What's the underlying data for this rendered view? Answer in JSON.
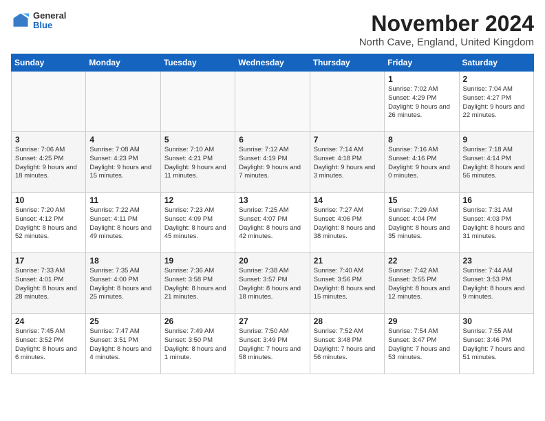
{
  "header": {
    "logo_general": "General",
    "logo_blue": "Blue",
    "month_title": "November 2024",
    "location": "North Cave, England, United Kingdom"
  },
  "weekdays": [
    "Sunday",
    "Monday",
    "Tuesday",
    "Wednesday",
    "Thursday",
    "Friday",
    "Saturday"
  ],
  "weeks": [
    [
      {
        "day": "",
        "info": ""
      },
      {
        "day": "",
        "info": ""
      },
      {
        "day": "",
        "info": ""
      },
      {
        "day": "",
        "info": ""
      },
      {
        "day": "",
        "info": ""
      },
      {
        "day": "1",
        "info": "Sunrise: 7:02 AM\nSunset: 4:29 PM\nDaylight: 9 hours and 26 minutes."
      },
      {
        "day": "2",
        "info": "Sunrise: 7:04 AM\nSunset: 4:27 PM\nDaylight: 9 hours and 22 minutes."
      }
    ],
    [
      {
        "day": "3",
        "info": "Sunrise: 7:06 AM\nSunset: 4:25 PM\nDaylight: 9 hours and 18 minutes."
      },
      {
        "day": "4",
        "info": "Sunrise: 7:08 AM\nSunset: 4:23 PM\nDaylight: 9 hours and 15 minutes."
      },
      {
        "day": "5",
        "info": "Sunrise: 7:10 AM\nSunset: 4:21 PM\nDaylight: 9 hours and 11 minutes."
      },
      {
        "day": "6",
        "info": "Sunrise: 7:12 AM\nSunset: 4:19 PM\nDaylight: 9 hours and 7 minutes."
      },
      {
        "day": "7",
        "info": "Sunrise: 7:14 AM\nSunset: 4:18 PM\nDaylight: 9 hours and 3 minutes."
      },
      {
        "day": "8",
        "info": "Sunrise: 7:16 AM\nSunset: 4:16 PM\nDaylight: 9 hours and 0 minutes."
      },
      {
        "day": "9",
        "info": "Sunrise: 7:18 AM\nSunset: 4:14 PM\nDaylight: 8 hours and 56 minutes."
      }
    ],
    [
      {
        "day": "10",
        "info": "Sunrise: 7:20 AM\nSunset: 4:12 PM\nDaylight: 8 hours and 52 minutes."
      },
      {
        "day": "11",
        "info": "Sunrise: 7:22 AM\nSunset: 4:11 PM\nDaylight: 8 hours and 49 minutes."
      },
      {
        "day": "12",
        "info": "Sunrise: 7:23 AM\nSunset: 4:09 PM\nDaylight: 8 hours and 45 minutes."
      },
      {
        "day": "13",
        "info": "Sunrise: 7:25 AM\nSunset: 4:07 PM\nDaylight: 8 hours and 42 minutes."
      },
      {
        "day": "14",
        "info": "Sunrise: 7:27 AM\nSunset: 4:06 PM\nDaylight: 8 hours and 38 minutes."
      },
      {
        "day": "15",
        "info": "Sunrise: 7:29 AM\nSunset: 4:04 PM\nDaylight: 8 hours and 35 minutes."
      },
      {
        "day": "16",
        "info": "Sunrise: 7:31 AM\nSunset: 4:03 PM\nDaylight: 8 hours and 31 minutes."
      }
    ],
    [
      {
        "day": "17",
        "info": "Sunrise: 7:33 AM\nSunset: 4:01 PM\nDaylight: 8 hours and 28 minutes."
      },
      {
        "day": "18",
        "info": "Sunrise: 7:35 AM\nSunset: 4:00 PM\nDaylight: 8 hours and 25 minutes."
      },
      {
        "day": "19",
        "info": "Sunrise: 7:36 AM\nSunset: 3:58 PM\nDaylight: 8 hours and 21 minutes."
      },
      {
        "day": "20",
        "info": "Sunrise: 7:38 AM\nSunset: 3:57 PM\nDaylight: 8 hours and 18 minutes."
      },
      {
        "day": "21",
        "info": "Sunrise: 7:40 AM\nSunset: 3:56 PM\nDaylight: 8 hours and 15 minutes."
      },
      {
        "day": "22",
        "info": "Sunrise: 7:42 AM\nSunset: 3:55 PM\nDaylight: 8 hours and 12 minutes."
      },
      {
        "day": "23",
        "info": "Sunrise: 7:44 AM\nSunset: 3:53 PM\nDaylight: 8 hours and 9 minutes."
      }
    ],
    [
      {
        "day": "24",
        "info": "Sunrise: 7:45 AM\nSunset: 3:52 PM\nDaylight: 8 hours and 6 minutes."
      },
      {
        "day": "25",
        "info": "Sunrise: 7:47 AM\nSunset: 3:51 PM\nDaylight: 8 hours and 4 minutes."
      },
      {
        "day": "26",
        "info": "Sunrise: 7:49 AM\nSunset: 3:50 PM\nDaylight: 8 hours and 1 minute."
      },
      {
        "day": "27",
        "info": "Sunrise: 7:50 AM\nSunset: 3:49 PM\nDaylight: 7 hours and 58 minutes."
      },
      {
        "day": "28",
        "info": "Sunrise: 7:52 AM\nSunset: 3:48 PM\nDaylight: 7 hours and 56 minutes."
      },
      {
        "day": "29",
        "info": "Sunrise: 7:54 AM\nSunset: 3:47 PM\nDaylight: 7 hours and 53 minutes."
      },
      {
        "day": "30",
        "info": "Sunrise: 7:55 AM\nSunset: 3:46 PM\nDaylight: 7 hours and 51 minutes."
      }
    ]
  ]
}
